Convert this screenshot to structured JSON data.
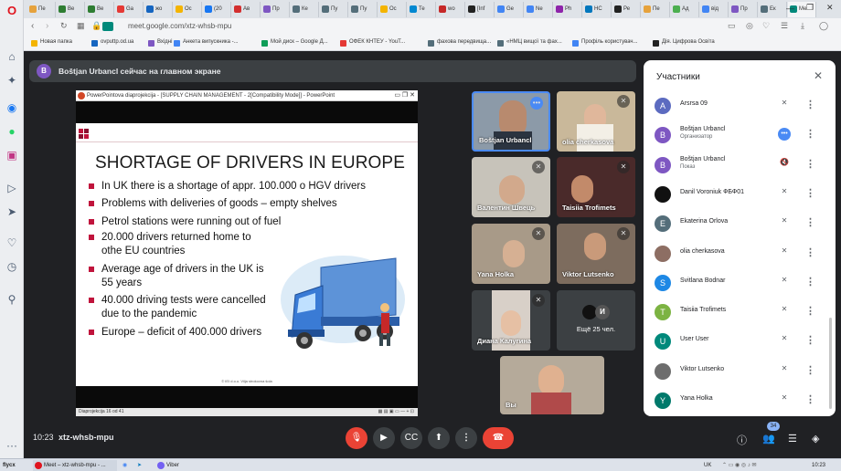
{
  "browser": {
    "tabs": [
      {
        "label": "Пе",
        "color": "#e6a23c"
      },
      {
        "label": "Ве",
        "color": "#2e7d32"
      },
      {
        "label": "Ве",
        "color": "#2e7d32"
      },
      {
        "label": "Ga",
        "color": "#e53935"
      },
      {
        "label": "жо",
        "color": "#1565c0"
      },
      {
        "label": "Ос",
        "color": "#f4b400"
      },
      {
        "label": "(20",
        "color": "#1877f2"
      },
      {
        "label": "Ав",
        "color": "#d32f2f"
      },
      {
        "label": "Пр",
        "color": "#7e57c2"
      },
      {
        "label": "Ке",
        "color": "#546e7a"
      },
      {
        "label": "Пу",
        "color": "#546e7a"
      },
      {
        "label": "Пу",
        "color": "#546e7a"
      },
      {
        "label": "Ос",
        "color": "#f4b400"
      },
      {
        "label": "Те",
        "color": "#0288d1"
      },
      {
        "label": "wo",
        "color": "#c62828"
      },
      {
        "label": "[Inf",
        "color": "#222"
      },
      {
        "label": "Ge",
        "color": "#4285f4"
      },
      {
        "label": "Ne",
        "color": "#4285f4"
      },
      {
        "label": "Ph",
        "color": "#8e24aa"
      },
      {
        "label": "НС",
        "color": "#0277bd"
      },
      {
        "label": "Ре",
        "color": "#222"
      },
      {
        "label": "Пе",
        "color": "#e6a23c"
      },
      {
        "label": "Ад",
        "color": "#4caf50"
      },
      {
        "label": "від",
        "color": "#4285f4"
      },
      {
        "label": "Пр",
        "color": "#7e57c2"
      },
      {
        "label": "Ек",
        "color": "#546e7a"
      },
      {
        "label": "Ме",
        "color": "#00897b"
      }
    ],
    "url": "meet.google.com/xtz-whsb-mpu",
    "bookmarks": [
      "Новая папка",
      "ovputtp.od.ua",
      "Вхідні",
      "Анкета випускника -...",
      "Мой диск – Google Д...",
      "ОФЕК КНТЕУ - YouT...",
      "фахова передвища...",
      "«НМЦ вищої та фах...",
      "Профіль користувач...",
      "Дія. Цифрова Освіта"
    ]
  },
  "meet": {
    "presenter_banner": "Boštjan Urbancl сейчас на главном экране",
    "presenter_initial": "B",
    "meeting_time": "10:23",
    "meeting_code": "xtz-whsb-mpu",
    "participant_count": "34",
    "slide_window": {
      "title": "PowerPointova diaprojekcija - [SUPPLY CHAIN MANAGEMENT - 2[Compatibility Mode]] - PowerPoint",
      "slide_title": "SHORTAGE OF DRIVERS IN EUROPE",
      "bullets": [
        "In UK there is a shortage of appr. 100.000 o HGV drivers",
        "Problems with deliveries of goods – empty shelves",
        "Petrol stations were running out of fuel",
        "20.000 drivers returned home to othe EU countries",
        "Average age of drivers in the UK is 55 years",
        "40.000 driving tests were cancelled due to the pandemic",
        "Europe – deficit of 400.000 drivers"
      ],
      "footer": "© IEI d.o.o. Vilja strokovna šola",
      "status": "Diaprojekcija 16 od 41"
    },
    "tiles": [
      {
        "name": "Boštjan Urbancl"
      },
      {
        "name": "olia cherkasova"
      },
      {
        "name": "Валентин Швець"
      },
      {
        "name": "Taisiia Trofimets"
      },
      {
        "name": "Yana Holka"
      },
      {
        "name": "Viktor Lutsenko"
      },
      {
        "name": "Диана Калугина"
      },
      {
        "name": "Ещё 25 чел.",
        "initial": "И"
      },
      {
        "name": "Вы"
      }
    ],
    "participants_panel": {
      "title": "Участники",
      "people": [
        {
          "initial": "A",
          "name": "Arsrsa 09",
          "role": "",
          "color": "#5c6bc0"
        },
        {
          "initial": "B",
          "name": "Boštjan Urbancl",
          "role": "Организатор",
          "color": "#7e57c2"
        },
        {
          "initial": "B",
          "name": "Boštjan Urbancl",
          "role": "Показ",
          "color": "#7e57c2"
        },
        {
          "initial": "",
          "name": "Danil Voroniuk ФБФ01",
          "role": "",
          "color": "#111111"
        },
        {
          "initial": "E",
          "name": "Ekaterina Orlova",
          "role": "",
          "color": "#546e7a"
        },
        {
          "initial": "",
          "name": "olia cherkasova",
          "role": "",
          "color": "#8d6e63"
        },
        {
          "initial": "S",
          "name": "Svitlana Bodnar",
          "role": "",
          "color": "#1e88e5"
        },
        {
          "initial": "T",
          "name": "Taisiia Trofimets",
          "role": "",
          "color": "#7cb342"
        },
        {
          "initial": "U",
          "name": "User User",
          "role": "",
          "color": "#00897b"
        },
        {
          "initial": "",
          "name": "Viktor Lutsenko",
          "role": "",
          "color": "#6d6d6d"
        },
        {
          "initial": "Y",
          "name": "Yana Holka",
          "role": "",
          "color": "#00796b"
        }
      ]
    }
  },
  "taskbar": {
    "start": "flycx",
    "items": [
      "Meet – xtz-whsb-mpu - ...",
      "Viber"
    ],
    "lang": "UK",
    "clock": "10:23"
  },
  "colors": {
    "end_call": "#ea4335",
    "mic_off": "#ea4335",
    "bullet": "#c0143c",
    "truck": "#3a7bd5"
  }
}
